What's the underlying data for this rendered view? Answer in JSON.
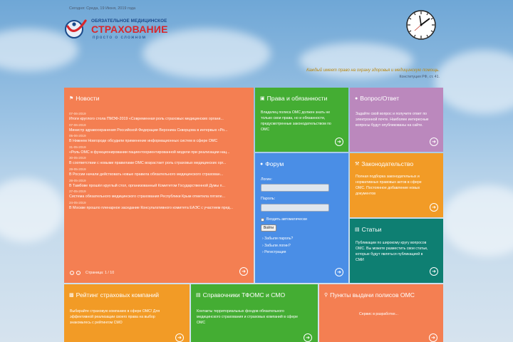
{
  "header": {
    "date": "Сегодня: Среда, 19 Июня, 2019 года",
    "logo_small": "ОБЯЗАТЕЛЬНОЕ МЕДИЦИНСКОЕ",
    "logo_big": "СТРАХОВАНИЕ",
    "logo_sub": "просто о сложном",
    "quote": "Каждый имеет право на охрану здоровья и медицинскую помощь.",
    "quote_source": "Конституция РФ, ст. 41."
  },
  "news": {
    "title": "Новости",
    "items": [
      {
        "date": "07-06-2019",
        "text": "Итоги круглого стола ПМЭФ-2019 «Современная роль страховых медицинских органи..."
      },
      {
        "date": "07-06-2019",
        "text": "Министр здравоохранения Российской Федерации Вероника Скворцова в интервью «Ро..."
      },
      {
        "date": "05-06-2019",
        "text": "В Нижнем Новгороде обсудили применение информационных систем в сфере ОМС"
      },
      {
        "date": "31-05-2019",
        "text": "«Роль ОМС в функционировании пациентоориентированной модели при реализации нац..."
      },
      {
        "date": "30-05-2019",
        "text": "В соответствии с новыми правилами ОМС возрастает роль страховых медицинских орг..."
      },
      {
        "date": "29-05-2019",
        "text": "В России начали действовать новые правила обязательного медицинского страхован..."
      },
      {
        "date": "28-05-2019",
        "text": "В Тамбове прошёл круглый стол, организованный Комитетом Государственной Думы п..."
      },
      {
        "date": "27-05-2019",
        "text": "Система обязательного медицинского страхования Республики Крым отметила пятиле..."
      },
      {
        "date": "24-05-2019",
        "text": "В Москве прошло пленарное заседание Консультативного комитета ЕАЭС с участием пред..."
      }
    ],
    "pager": "Страница: 1 / 10"
  },
  "rights": {
    "title": "Права и обязанности",
    "text": [
      "Владелец полиса ОМС должен знать не",
      "только свои права, но и обязанности,",
      "предусмотренные законодательством по",
      "ОМС"
    ]
  },
  "qa": {
    "title": "Вопрос/Ответ",
    "text": [
      "Задайте свой вопрос и получите ответ по",
      "электронной почте. Наиболее интересные",
      "вопросы будут опубликованы на сайте."
    ]
  },
  "forum": {
    "title": "Форум",
    "login_label": "Логин:",
    "password_label": "Пароль:",
    "remember_label": "Входить автоматически",
    "login_button": "Войти",
    "links": [
      "Забыли пароль?",
      "Забыли логин?",
      "Регистрация"
    ]
  },
  "law": {
    "title": "Законодательство",
    "text": [
      "Полная подборка законодательных и",
      "нормативных правовых актов в сфере",
      "ОМС. Постоянное добавление новых",
      "документов"
    ]
  },
  "articles": {
    "title": "Статьи",
    "text": [
      "Публикации по широкому кругу вопросов",
      "ОМС. Вы можете разместить свои статьи,",
      "которые будут являться публикацией в",
      "СМИ"
    ]
  },
  "rating": {
    "title": "Рейтинг страховых компаний",
    "text": [
      "Выбирайте страховую компанию в сфере ОМС! Для",
      "эффективной реализации своего права на выбор",
      "знакомьтесь с рейтингом СМО"
    ]
  },
  "directory": {
    "title": "Справочники ТФОМС и СМО",
    "text": [
      "Контакты территориальных фондов обязательного",
      "медицинского страхования и страховых компаний в сфере",
      "ОМС"
    ]
  },
  "points": {
    "title": "Пункты выдачи полисов ОМС",
    "text": "Сервис в разработке..."
  },
  "colors": {
    "news": "#f47f52",
    "rights": "#44ad33",
    "qa": "#bb88bd",
    "forum": "#4a8ee6",
    "law": "#f29b26",
    "articles": "#0e7f72",
    "rating": "#f29b26",
    "directory": "#44ad33",
    "points": "#f47f52"
  },
  "icons": {
    "news": "bullhorn-icon",
    "rights": "briefcase-icon",
    "qa": "chat-icon",
    "forum": "comments-icon",
    "law": "gavel-icon",
    "articles": "newspaper-icon",
    "rating": "chart-icon",
    "directory": "book-icon",
    "points": "map-marker-icon"
  }
}
